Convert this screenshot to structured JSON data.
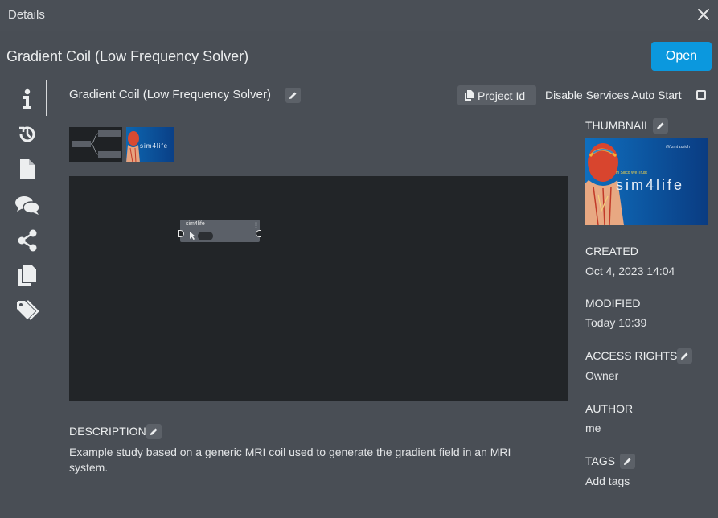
{
  "window": {
    "title": "Details"
  },
  "header": {
    "title": "Gradient Coil (Low Frequency Solver)",
    "open_label": "Open"
  },
  "sidebar": {
    "items": [
      {
        "icon": "info-icon"
      },
      {
        "icon": "history-icon"
      },
      {
        "icon": "file-icon"
      },
      {
        "icon": "comments-icon"
      },
      {
        "icon": "share-icon"
      },
      {
        "icon": "copy-icon"
      },
      {
        "icon": "tags-icon"
      }
    ]
  },
  "study": {
    "title": "Gradient Coil (Low Frequency Solver)",
    "project_id_label": "Project Id",
    "disable_services_label": "Disable Services Auto Start",
    "disable_services_checked": false
  },
  "workbench": {
    "node_label": "sim4life"
  },
  "thumbnail": {
    "brand": "sim4life",
    "tagline": "In Silico We Trust",
    "corner": "//// zmt zurich"
  },
  "details": {
    "thumbnail_label": "THUMBNAIL",
    "created_label": "CREATED",
    "created_value": "Oct 4, 2023 14:04",
    "modified_label": "MODIFIED",
    "modified_value": "Today 10:39",
    "access_label": "ACCESS RIGHTS",
    "access_value": "Owner",
    "author_label": "AUTHOR",
    "author_value": "me",
    "tags_label": "TAGS",
    "tags_value": "Add tags"
  },
  "description": {
    "label": "DESCRIPTION",
    "text": "Example study based on a generic MRI coil used to generate the gradient field in an MRI system."
  },
  "colors": {
    "accent": "#0b98de",
    "background": "#494e55",
    "canvas": "#222528"
  }
}
